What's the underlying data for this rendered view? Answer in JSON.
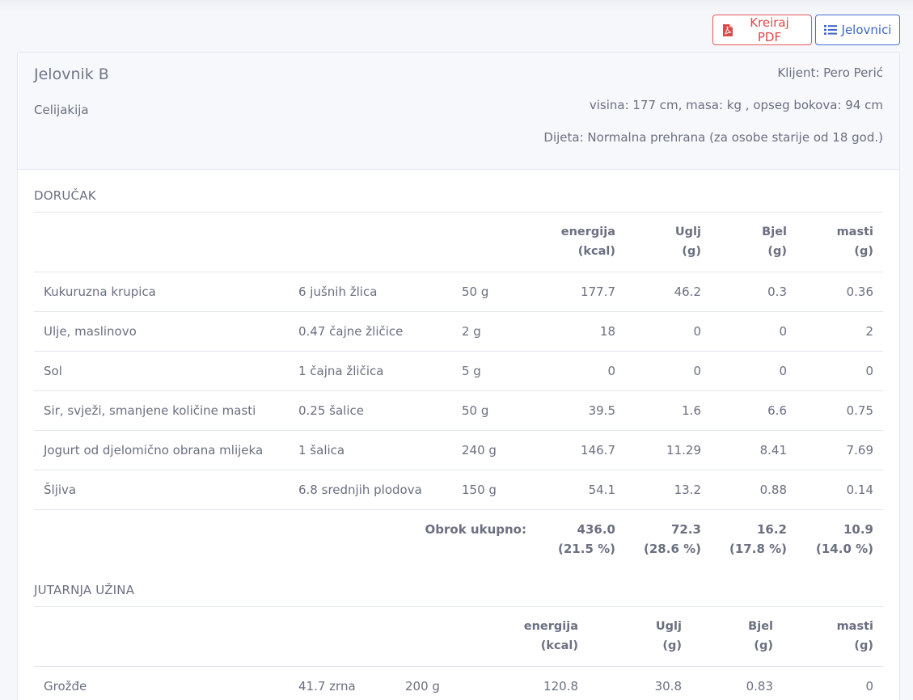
{
  "toolbar": {
    "pdf_label": "Kreiraj PDF",
    "menus_label": "Jelovnici",
    "pdf_icon": "file-pdf-icon",
    "menus_icon": "list-icon",
    "pdf_color": "#e04848",
    "menus_color": "#3c63c9"
  },
  "header": {
    "title": "Jelovnik B",
    "subtitle": "Celijakija",
    "client": "Klijent: Pero Perić",
    "measures": "visina: 177 cm, masa: kg , opseg bokova: 94 cm",
    "diet": "Dijeta: Normalna prehrana (za osobe starije od 18 god.)"
  },
  "meals": [
    {
      "title": "DORUČAK",
      "columns": {
        "energy": [
          "energija",
          "(kcal)"
        ],
        "carbs": [
          "Uglj",
          "(g)"
        ],
        "protein": [
          "Bjel",
          "(g)"
        ],
        "fat": [
          "masti",
          "(g)"
        ]
      },
      "rows": [
        {
          "name": "Kukuruzna krupica",
          "portion": "6 jušnih žlica",
          "weight": "50 g",
          "energy": "177.7",
          "carbs": "46.2",
          "protein": "0.3",
          "fat": "0.36"
        },
        {
          "name": "Ulje, maslinovo",
          "portion": "0.47 čajne žličice",
          "weight": "2 g",
          "energy": "18",
          "carbs": "0",
          "protein": "0",
          "fat": "2"
        },
        {
          "name": "Sol",
          "portion": "1 čajna žličica",
          "weight": "5 g",
          "energy": "0",
          "carbs": "0",
          "protein": "0",
          "fat": "0"
        },
        {
          "name": "Sir, svježi, smanjene količine masti",
          "portion": "0.25 šalice",
          "weight": "50 g",
          "energy": "39.5",
          "carbs": "1.6",
          "protein": "6.6",
          "fat": "0.75"
        },
        {
          "name": "Jogurt od djelomično obrana mlijeka",
          "portion": "1 šalica",
          "weight": "240 g",
          "energy": "146.7",
          "carbs": "11.29",
          "protein": "8.41",
          "fat": "7.69"
        },
        {
          "name": "Šljiva",
          "portion": "6.8 srednjih plodova",
          "weight": "150 g",
          "energy": "54.1",
          "carbs": "13.2",
          "protein": "0.88",
          "fat": "0.14"
        }
      ],
      "total": {
        "label": "Obrok ukupno:",
        "energy": [
          "436.0",
          "(21.5 %)"
        ],
        "carbs": [
          "72.3",
          "(28.6 %)"
        ],
        "protein": [
          "16.2",
          "(17.8 %)"
        ],
        "fat": [
          "10.9",
          "(14.0 %)"
        ]
      }
    },
    {
      "title": "JUTARNJA UŽINA",
      "columns": {
        "energy": [
          "energija",
          "(kcal)"
        ],
        "carbs": [
          "Uglj",
          "(g)"
        ],
        "protein": [
          "Bjel",
          "(g)"
        ],
        "fat": [
          "masti",
          "(g)"
        ]
      },
      "rows": [
        {
          "name": "Grožđe",
          "portion": "41.7 zrna",
          "weight": "200 g",
          "energy": "120.8",
          "carbs": "30.8",
          "protein": "0.83",
          "fat": "0"
        }
      ]
    }
  ]
}
